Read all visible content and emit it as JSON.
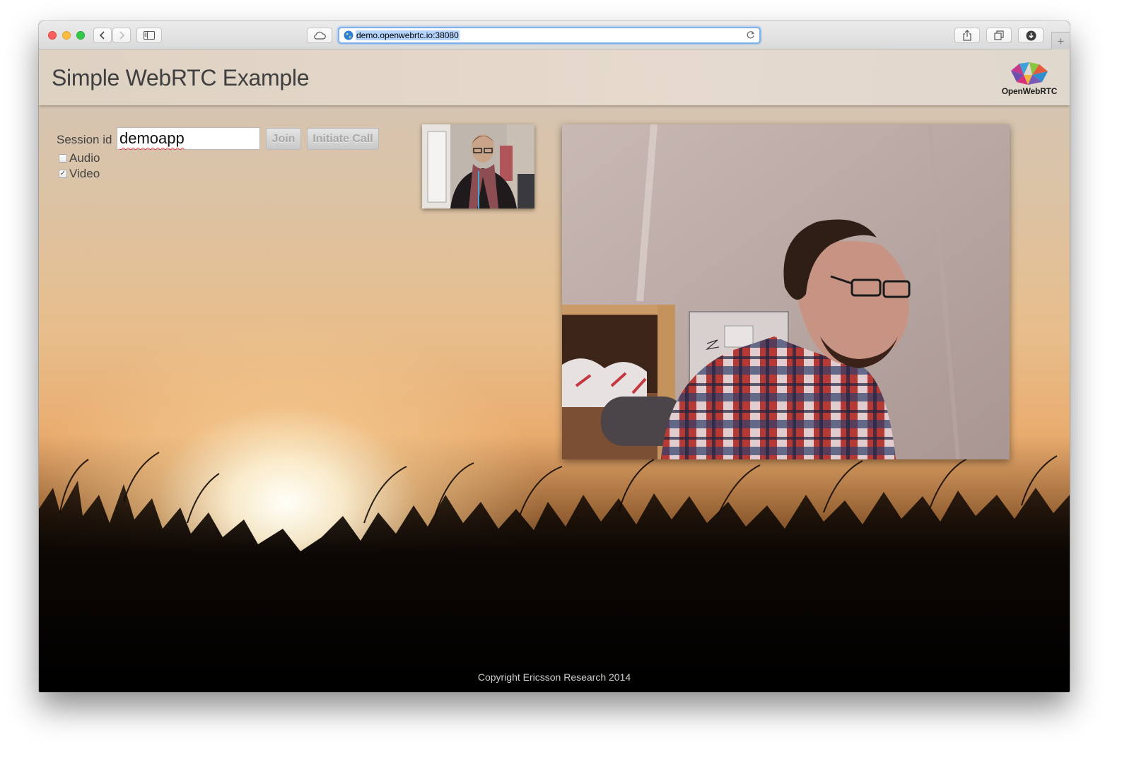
{
  "browser": {
    "url": "demo.openwebrtc.io:38080",
    "new_tab_symbol": "+",
    "icons": [
      "back-icon",
      "forward-icon",
      "sidebar-icon",
      "icloud-icon",
      "globe-icon",
      "reload-icon",
      "share-icon",
      "tabs-icon",
      "downloads-icon"
    ]
  },
  "header": {
    "title": "Simple WebRTC Example",
    "logo_text": "OpenWebRTC"
  },
  "form": {
    "session_label": "Session id",
    "session_value": "demoapp",
    "join_label": "Join",
    "initiate_label": "Initiate Call",
    "audio_label": "Audio",
    "audio_checked": false,
    "video_label": "Video",
    "video_checked": true,
    "check_mark": "✓"
  },
  "footer": {
    "copyright": "Copyright Ericsson Research 2014"
  },
  "colors": {
    "address_focus": "#7fb0ea",
    "title_text": "#3f3f3f",
    "button_disabled_text": "#a8a8a8"
  }
}
